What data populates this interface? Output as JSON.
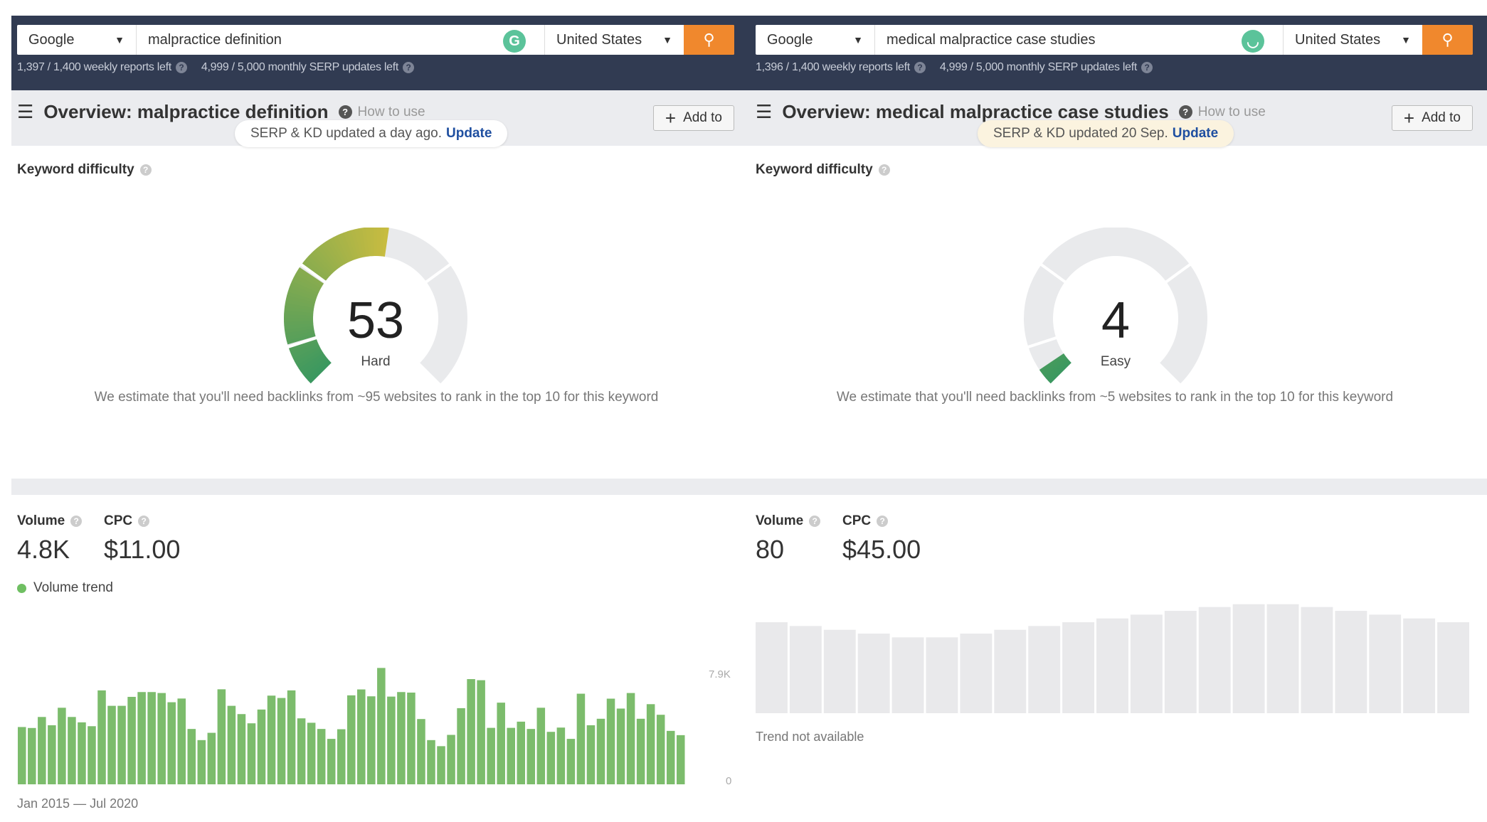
{
  "colors": {
    "topbar": "#313b52",
    "search_button": "#f0882d",
    "volume_bar": "#7cbc6c",
    "placeholder_bar": "#e9e9eb",
    "update_link": "#1f4fa0",
    "gauge_track": "#e9eaec"
  },
  "panes": [
    {
      "search": {
        "engine": "Google",
        "keyword": "malpractice definition",
        "country": "United States",
        "extension_icon": "grammarly-icon"
      },
      "stats": {
        "weekly": "1,397 / 1,400 weekly reports left",
        "monthly": "4,999 / 5,000 monthly SERP updates left"
      },
      "header": {
        "title": "Overview: malpractice definition",
        "how_to": "How to use",
        "add_to": "Add to"
      },
      "toast": {
        "text": "SERP & KD updated a day ago.",
        "link": "Update"
      },
      "kd": {
        "label": "Keyword difficulty",
        "value": "53",
        "score": 53,
        "rating": "Hard",
        "estimate": "We estimate that you'll need backlinks from ~95 websites to rank in the top 10 for this keyword"
      },
      "metrics": {
        "volume_label": "Volume",
        "volume": "4.8K",
        "cpc_label": "CPC",
        "cpc": "$11.00"
      },
      "trend": {
        "legend": "Volume trend",
        "footer": "Jan 2015 — Jul 2020"
      }
    },
    {
      "search": {
        "engine": "Google",
        "keyword": "medical malpractice case studies",
        "country": "United States",
        "extension_icon": "grammarly-icon"
      },
      "stats": {
        "weekly": "1,396 / 1,400 weekly reports left",
        "monthly": "4,999 / 5,000 monthly SERP updates left"
      },
      "header": {
        "title": "Overview: medical malpractice case studies",
        "how_to": "How to use",
        "add_to": "Add to"
      },
      "toast": {
        "text": "SERP & KD updated 20 Sep.",
        "link": "Update"
      },
      "kd": {
        "label": "Keyword difficulty",
        "value": "4",
        "score": 4,
        "rating": "Easy",
        "estimate": "We estimate that you'll need backlinks from ~5 websites to rank in the top 10 for this keyword"
      },
      "metrics": {
        "volume_label": "Volume",
        "volume": "80",
        "cpc_label": "CPC",
        "cpc": "$45.00"
      },
      "trend": {
        "footer": "Trend not available"
      }
    }
  ],
  "chart_data": {
    "type": "bar",
    "series": [
      {
        "name": "Volume trend",
        "unit": "K",
        "values": [
          4.16,
          4.09,
          4.89,
          4.29,
          5.56,
          4.89,
          4.5,
          4.22,
          6.82,
          5.7,
          5.7,
          6.35,
          6.7,
          6.7,
          6.63,
          5.96,
          6.23,
          4.02,
          3.21,
          3.74,
          6.9,
          5.7,
          5.1,
          4.43,
          5.43,
          6.44,
          6.27,
          6.82,
          4.79,
          4.47,
          4.02,
          3.3,
          4.0,
          6.46,
          6.89,
          6.39,
          8.45,
          6.37,
          6.7,
          6.66,
          4.74,
          3.21,
          2.77,
          3.59,
          5.53,
          7.64,
          7.56,
          4.1,
          5.93,
          4.1,
          4.55,
          4.02,
          5.56,
          3.81,
          4.12,
          3.3,
          6.58,
          4.29,
          4.76,
          6.22,
          5.5,
          6.63,
          4.76,
          5.82,
          5.05,
          3.88,
          3.57
        ]
      }
    ],
    "x_range": [
      "Jan 2015",
      "Jul 2020"
    ],
    "y_ticks": [
      "7.9K",
      "0"
    ],
    "ylim": [
      0,
      7.9
    ],
    "grid": false
  }
}
